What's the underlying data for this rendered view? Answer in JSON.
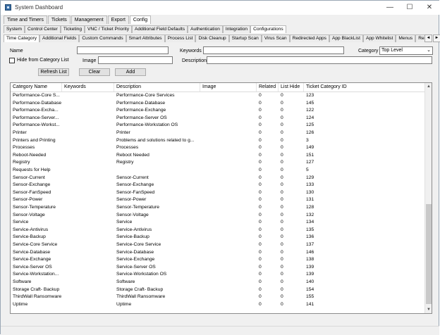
{
  "window": {
    "title": "System Dashboard",
    "minimize": "—",
    "maximize": "☐",
    "close": "✕"
  },
  "menu": [
    "Time and Timers",
    "Tickets",
    "Management",
    "Export",
    "Config"
  ],
  "tabs_row1": [
    "System",
    "Control Center",
    "Ticketing",
    "VNC / Ticket Priority",
    "Additional Field Defaults",
    "Authentication",
    "Integration",
    "Configurations"
  ],
  "tabs_row2": [
    "Time Category",
    "Additional Fields",
    "Custom Commands",
    "Smart Attributes",
    "Process List",
    "Disk Cleanup",
    "Startup Scan",
    "Virus Scan",
    "Redirected Apps",
    "App BlackList",
    "App Whitelist",
    "Menus",
    "Reg"
  ],
  "form": {
    "name_label": "Name",
    "keywords_label": "Keywords",
    "category_label": "Category",
    "category_value": "Top Level",
    "hide_label": "Hide from Category List",
    "image_label": "Image",
    "description_label": "Description",
    "refresh_label": "Refresh List",
    "clear_label": "Clear",
    "add_label": "Add"
  },
  "table": {
    "columns": [
      "Category Name",
      "Keywords",
      "Description",
      "Image",
      "Related",
      "List Hide",
      "Ticket Category ID"
    ],
    "rows": [
      [
        "Performance-Core S...",
        "",
        "Performance-Core Services",
        "",
        "0",
        "0",
        "123"
      ],
      [
        "Performance-Database",
        "",
        "Performance-Database",
        "",
        "0",
        "0",
        "145"
      ],
      [
        "Performance-Excha...",
        "",
        "Performance-Exchange",
        "",
        "0",
        "0",
        "122"
      ],
      [
        "Performance-Server...",
        "",
        "Performance-Server OS",
        "",
        "0",
        "0",
        "124"
      ],
      [
        "Performance-Workst...",
        "",
        "Performance-Workstation OS",
        "",
        "0",
        "0",
        "125"
      ],
      [
        "Printer",
        "",
        "Printer",
        "",
        "0",
        "0",
        "126"
      ],
      [
        "Printers and Printing",
        "",
        "Problems and solutions related to g...",
        "",
        "0",
        "0",
        "3"
      ],
      [
        "Processes",
        "",
        "Processes",
        "",
        "0",
        "0",
        "149"
      ],
      [
        "Reboot-Needed",
        "",
        "Reboot Needed",
        "",
        "0",
        "0",
        "151"
      ],
      [
        "Registry",
        "",
        "Registry",
        "",
        "0",
        "0",
        "127"
      ],
      [
        "Requests for Help",
        "",
        "",
        "",
        "0",
        "0",
        "5"
      ],
      [
        "Sensor-Current",
        "",
        "Sensor-Current",
        "",
        "0",
        "0",
        "129"
      ],
      [
        "Sensor-Exchange",
        "",
        "Sensor-Exchange",
        "",
        "0",
        "0",
        "133"
      ],
      [
        "Sensor-FanSpeed",
        "",
        "Sensor-FanSpeed",
        "",
        "0",
        "0",
        "130"
      ],
      [
        "Sensor-Power",
        "",
        "Sensor-Power",
        "",
        "0",
        "0",
        "131"
      ],
      [
        "Sensor-Temperature",
        "",
        "Sensor-Temperature",
        "",
        "0",
        "0",
        "128"
      ],
      [
        "Sensor-Voltage",
        "",
        "Sensor-Voltage",
        "",
        "0",
        "0",
        "132"
      ],
      [
        "Service",
        "",
        "Service",
        "",
        "0",
        "0",
        "134"
      ],
      [
        "Service-Antivirus",
        "",
        "Service-Antivirus",
        "",
        "0",
        "0",
        "135"
      ],
      [
        "Service-Backup",
        "",
        "Service-Backup",
        "",
        "0",
        "0",
        "136"
      ],
      [
        "Service-Core Service",
        "",
        "Service-Core Service",
        "",
        "0",
        "0",
        "137"
      ],
      [
        "Service-Database",
        "",
        "Service-Database",
        "",
        "0",
        "0",
        "146"
      ],
      [
        "Service-Exchange",
        "",
        "Service-Exchange",
        "",
        "0",
        "0",
        "138"
      ],
      [
        "Service-Server OS",
        "",
        "Service-Server OS",
        "",
        "0",
        "0",
        "139"
      ],
      [
        "Service-Workstation...",
        "",
        "Service-Workstation OS",
        "",
        "0",
        "0",
        "139"
      ],
      [
        "Software",
        "",
        "Software",
        "",
        "0",
        "0",
        "140"
      ],
      [
        "Storage Craft- Backup",
        "",
        "Storage Craft- Backup",
        "",
        "0",
        "0",
        "154"
      ],
      [
        "ThirdWall Ransomware",
        "",
        "ThirdWall Ransomware",
        "",
        "0",
        "0",
        "155"
      ],
      [
        "Uptime",
        "",
        "Uptime",
        "",
        "0",
        "0",
        "141"
      ]
    ]
  },
  "scroll": {
    "up": "▲",
    "down": "▼",
    "left": "◄",
    "right": "►"
  }
}
